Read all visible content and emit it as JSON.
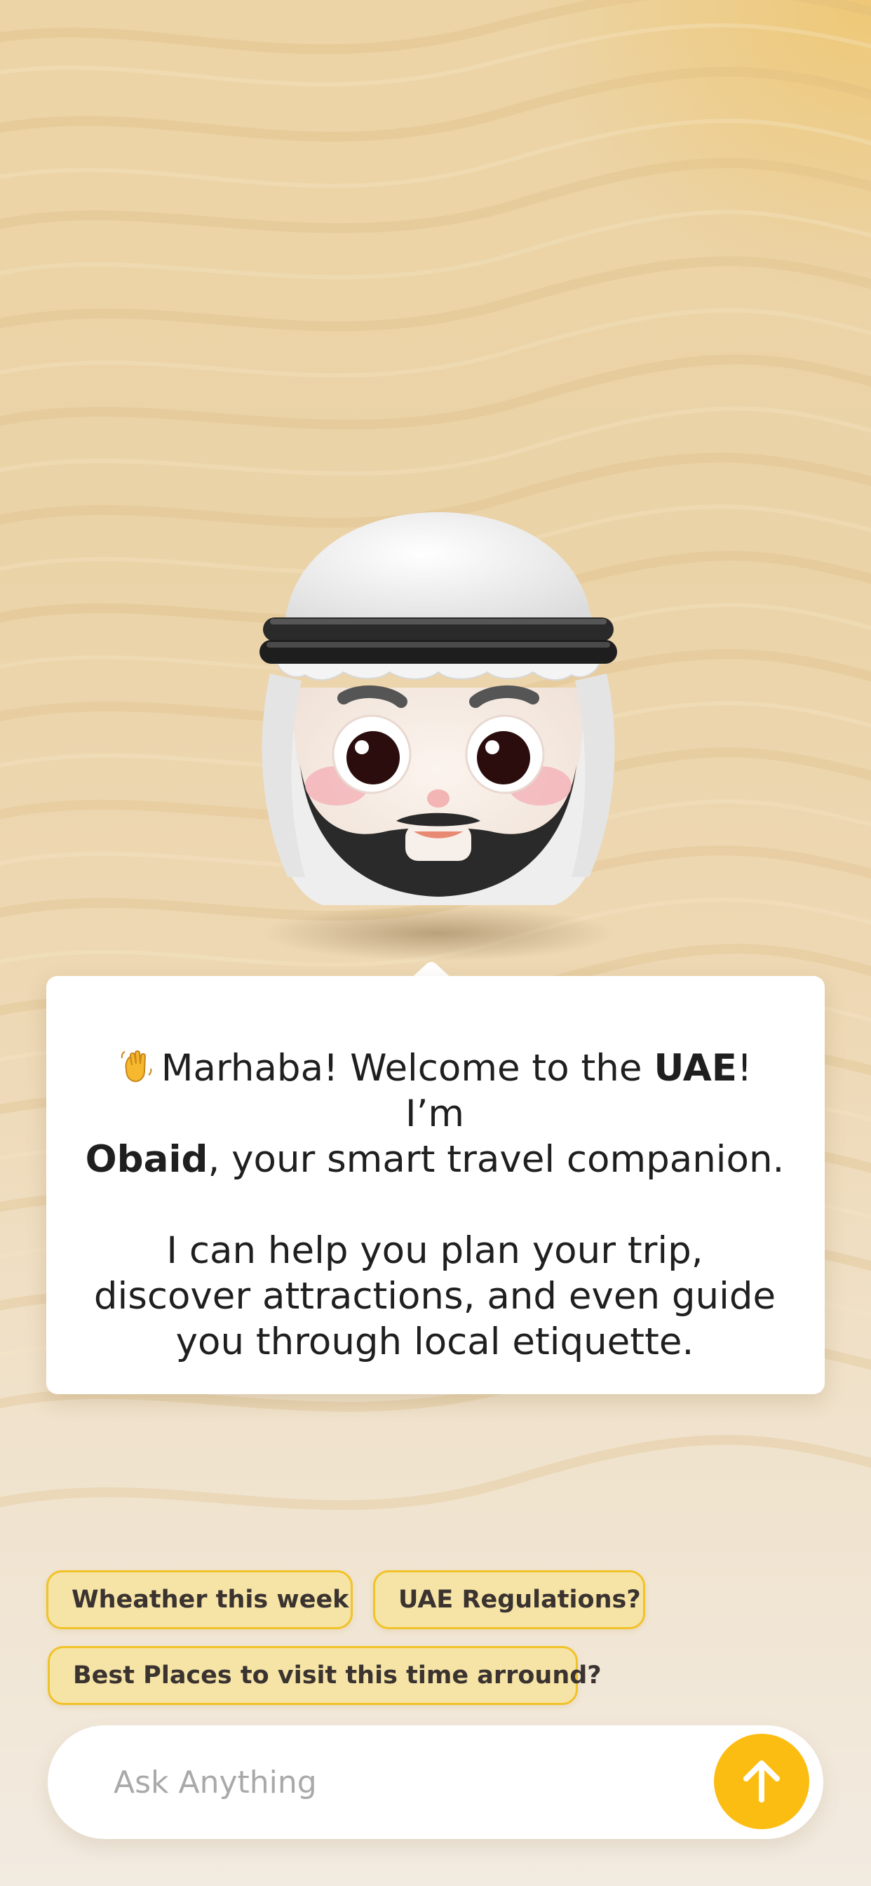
{
  "colors": {
    "accent": "#fcbd13",
    "chip_border": "#f2c229",
    "chip_fill": "#f6e4a6",
    "background_sand": "#ebd3a8"
  },
  "mascot": {
    "icon": "emirati-man-avatar"
  },
  "message": {
    "emoji": "waving-hand-icon",
    "line1_part1": "Marhaba! Welcome to the ",
    "line1_bold": "UAE",
    "line1_part2": "! I’m",
    "line2_bold": "Obaid",
    "line2_part2": ", your smart travel companion.",
    "paragraph2": "I can help you plan your trip, discover attractions, and even guide you through local etiquette."
  },
  "suggestions": [
    "Wheather this week",
    "UAE Regulations?",
    "Best Places to visit this time arround?"
  ],
  "input": {
    "placeholder": "Ask Anything",
    "value": "",
    "send_icon": "arrow-up-icon"
  }
}
